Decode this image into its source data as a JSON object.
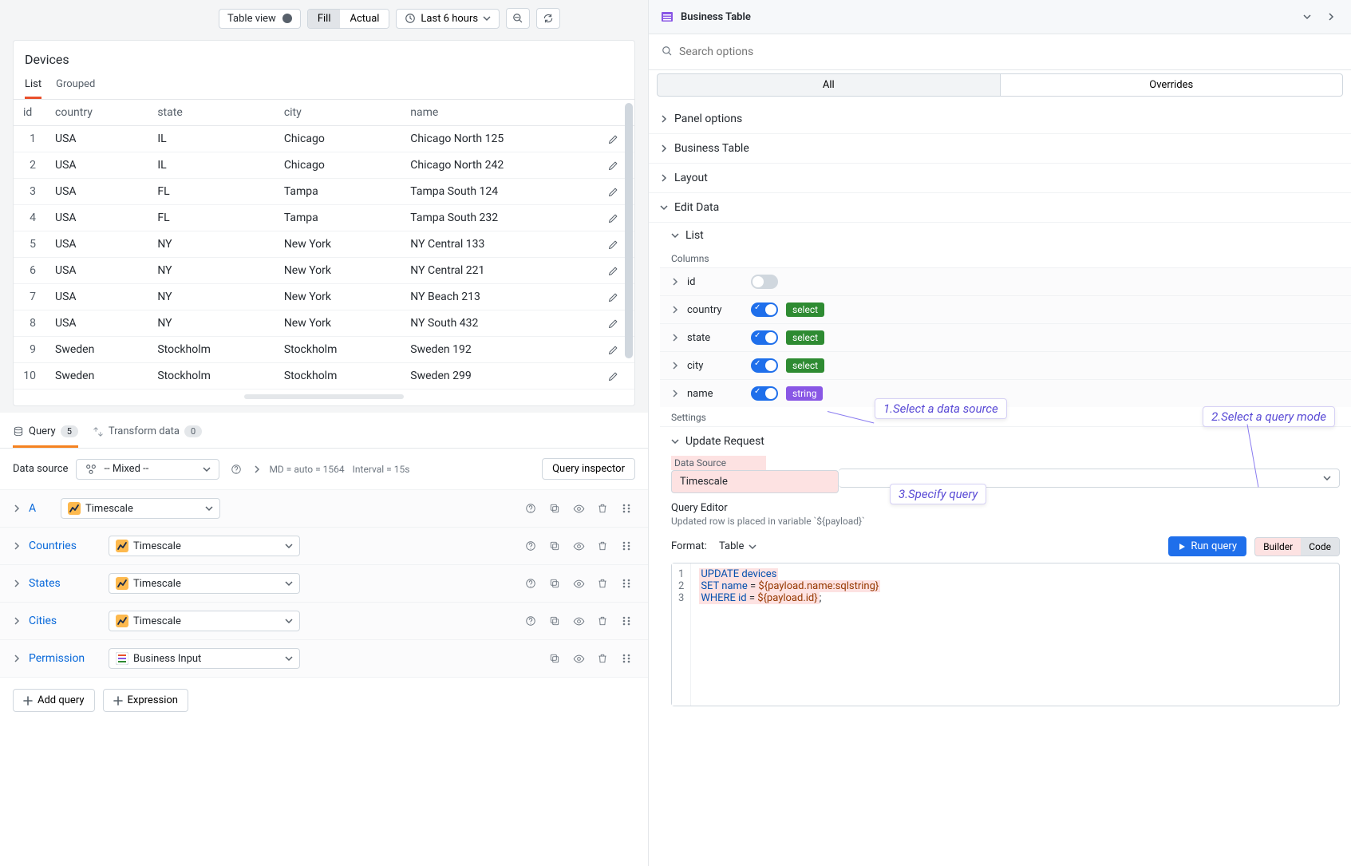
{
  "toolbar": {
    "table_view": "Table view",
    "fill": "Fill",
    "actual": "Actual",
    "time_range": "Last 6 hours"
  },
  "panel": {
    "title": "Devices",
    "tabs": {
      "list": "List",
      "grouped": "Grouped"
    },
    "columns": [
      "id",
      "country",
      "state",
      "city",
      "name"
    ],
    "rows": [
      {
        "id": "1",
        "country": "USA",
        "state": "IL",
        "city": "Chicago",
        "name": "Chicago North 125"
      },
      {
        "id": "2",
        "country": "USA",
        "state": "IL",
        "city": "Chicago",
        "name": "Chicago North 242"
      },
      {
        "id": "3",
        "country": "USA",
        "state": "FL",
        "city": "Tampa",
        "name": "Tampa South 124"
      },
      {
        "id": "4",
        "country": "USA",
        "state": "FL",
        "city": "Tampa",
        "name": "Tampa South 232"
      },
      {
        "id": "5",
        "country": "USA",
        "state": "NY",
        "city": "New York",
        "name": "NY Central 133"
      },
      {
        "id": "6",
        "country": "USA",
        "state": "NY",
        "city": "New York",
        "name": "NY Central 221"
      },
      {
        "id": "7",
        "country": "USA",
        "state": "NY",
        "city": "New York",
        "name": "NY Beach 213"
      },
      {
        "id": "8",
        "country": "USA",
        "state": "NY",
        "city": "New York",
        "name": "NY South 432"
      },
      {
        "id": "9",
        "country": "Sweden",
        "state": "Stockholm",
        "city": "Stockholm",
        "name": "Sweden 192"
      },
      {
        "id": "10",
        "country": "Sweden",
        "state": "Stockholm",
        "city": "Stockholm",
        "name": "Sweden 299"
      }
    ]
  },
  "query_section": {
    "tab_query": "Query",
    "tab_query_count": "5",
    "tab_transform": "Transform data",
    "tab_transform_count": "0",
    "ds_label": "Data source",
    "ds_value": "-- Mixed --",
    "md": "MD = auto = 1564",
    "interval": "Interval = 15s",
    "inspector": "Query inspector",
    "rows": [
      {
        "name": "A",
        "ds": "Timescale",
        "narrow": true,
        "icons": [
          "help",
          "dup",
          "eye",
          "trash",
          "drag"
        ]
      },
      {
        "name": "Countries",
        "ds": "Timescale",
        "icons": [
          "help",
          "dup",
          "eye",
          "trash",
          "drag"
        ]
      },
      {
        "name": "States",
        "ds": "Timescale",
        "icons": [
          "help",
          "dup",
          "eye",
          "trash",
          "drag"
        ]
      },
      {
        "name": "Cities",
        "ds": "Timescale",
        "icons": [
          "help",
          "dup",
          "eye",
          "trash",
          "drag"
        ]
      },
      {
        "name": "Permission",
        "ds": "Business Input",
        "bi": true,
        "icons": [
          "dup",
          "eye",
          "trash",
          "drag"
        ]
      }
    ],
    "add_query": "Add query",
    "add_expression": "Expression"
  },
  "right": {
    "title": "Business Table",
    "search_placeholder": "Search options",
    "tab_all": "All",
    "tab_overrides": "Overrides",
    "sections": {
      "panel_options": "Panel options",
      "business_table": "Business Table",
      "layout": "Layout",
      "edit_data": "Edit Data"
    },
    "list_label": "List",
    "columns_label": "Columns",
    "cols": [
      {
        "name": "id",
        "on": false,
        "tag": ""
      },
      {
        "name": "country",
        "on": true,
        "tag": "select"
      },
      {
        "name": "state",
        "on": true,
        "tag": "select"
      },
      {
        "name": "city",
        "on": true,
        "tag": "select"
      },
      {
        "name": "name",
        "on": true,
        "tag": "string"
      }
    ],
    "settings_label": "Settings",
    "update_request": "Update Request",
    "ds_label": "Data Source",
    "ds_value": "Timescale",
    "qe_label": "Query Editor",
    "qe_hint": "Updated row is placed in variable `${payload}`",
    "format_label": "Format:",
    "format_value": "Table",
    "run_query": "Run query",
    "mode_builder": "Builder",
    "mode_code": "Code",
    "code": {
      "l1": "UPDATE devices",
      "l2a": "SET name ",
      "l2b": "= ",
      "l2c": "${payload.name:sqlstring}",
      "l3a": "WHERE id ",
      "l3b": "= ",
      "l3c": "${payload.id}",
      "l3d": ";"
    }
  },
  "annotations": {
    "a1": "1.Select a data source",
    "a2": "2.Select a query mode",
    "a3": "3.Specify query"
  }
}
